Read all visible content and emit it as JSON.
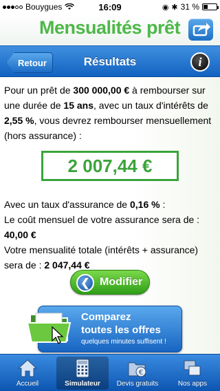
{
  "status_bar": {
    "carrier": "Bouygues",
    "time": "16:09",
    "battery": "31 %",
    "battery_level": 0.31
  },
  "header": {
    "app_title": "Mensualités prêt",
    "share_icon": "share-icon"
  },
  "navbar": {
    "back_label": "Retour",
    "title": "Résultats",
    "info_label": "i"
  },
  "intro": {
    "t1": "Pour un prêt de ",
    "amount": "300 000,00 €",
    "t2": " à rembourser sur une durée de ",
    "duration": "15 ans",
    "t3": ", avec un taux d'intérêts de ",
    "rate": "2,55 %",
    "t4": ", vous devrez rembourser mensuellement (hors assurance) :"
  },
  "result": {
    "monthly": "2 007,44 €"
  },
  "details": {
    "t1": "Avec un taux d'assurance de ",
    "insurance_rate": "0,16 %",
    "t2": " :",
    "t3": "Le coût mensuel de votre assurance sera de :",
    "insurance_cost": "40,00 €",
    "t4": "Votre mensualité totale (intérêts + assurance) sera de : ",
    "total": "2 047,44 €"
  },
  "modify_button": {
    "label": "Modifier"
  },
  "compare": {
    "line1": "Comparez",
    "line2": "toutes les offres",
    "sub": "quelques minutes suffisent !"
  },
  "tabs": [
    {
      "label": "Accueil",
      "icon": "home-icon"
    },
    {
      "label": "Simulateur",
      "icon": "calculator-icon",
      "active": true
    },
    {
      "label": "Devis gratuits",
      "icon": "folder-euro-icon"
    },
    {
      "label": "Nos apps",
      "icon": "apps-icon"
    }
  ],
  "colors": {
    "brand_green": "#4db848",
    "result_green": "#3aa43a",
    "nav_blue": "#1262c1"
  }
}
